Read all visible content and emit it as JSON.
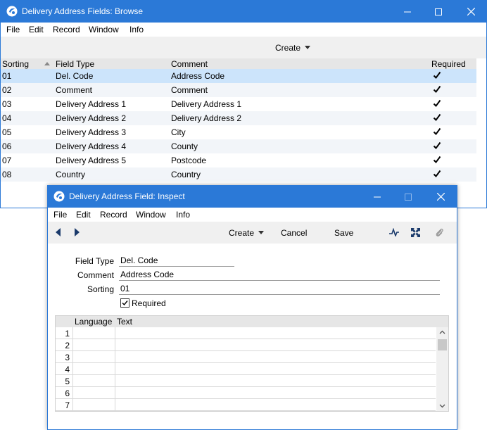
{
  "browse": {
    "title": "Delivery Address Fields: Browse",
    "menu": [
      "File",
      "Edit",
      "Record",
      "Window",
      "Info"
    ],
    "toolbar": {
      "create_label": "Create"
    },
    "columns": {
      "sorting": "Sorting",
      "field_type": "Field Type",
      "comment": "Comment",
      "required": "Required"
    },
    "rows": [
      {
        "sorting": "01",
        "field_type": "Del. Code",
        "comment": "Address Code",
        "required": true
      },
      {
        "sorting": "02",
        "field_type": "Comment",
        "comment": "Comment",
        "required": true
      },
      {
        "sorting": "03",
        "field_type": "Delivery Address 1",
        "comment": "Delivery Address 1",
        "required": true
      },
      {
        "sorting": "04",
        "field_type": "Delivery Address 2",
        "comment": "Delivery Address 2",
        "required": true
      },
      {
        "sorting": "05",
        "field_type": "Delivery Address 3",
        "comment": "City",
        "required": true
      },
      {
        "sorting": "06",
        "field_type": "Delivery Address 4",
        "comment": "County",
        "required": true
      },
      {
        "sorting": "07",
        "field_type": "Delivery Address 5",
        "comment": "Postcode",
        "required": true
      },
      {
        "sorting": "08",
        "field_type": "Country",
        "comment": "Country",
        "required": true
      }
    ]
  },
  "inspect": {
    "title": "Delivery Address Field: Inspect",
    "menu": [
      "File",
      "Edit",
      "Record",
      "Window",
      "Info"
    ],
    "toolbar": {
      "create_label": "Create",
      "cancel_label": "Cancel",
      "save_label": "Save"
    },
    "fields": {
      "field_type_label": "Field Type",
      "field_type_value": "Del. Code",
      "comment_label": "Comment",
      "comment_value": "Address Code",
      "sorting_label": "Sorting",
      "sorting_value": "01",
      "required_label": "Required",
      "required_checked": true
    },
    "matrix": {
      "columns": {
        "language": "Language",
        "text": "Text"
      },
      "row_numbers": [
        "1",
        "2",
        "3",
        "4",
        "5",
        "6",
        "7"
      ]
    }
  },
  "colors": {
    "titlebar": "#2b79d7",
    "selection": "#cce4fb",
    "toolbar": "#f0f0f0"
  }
}
